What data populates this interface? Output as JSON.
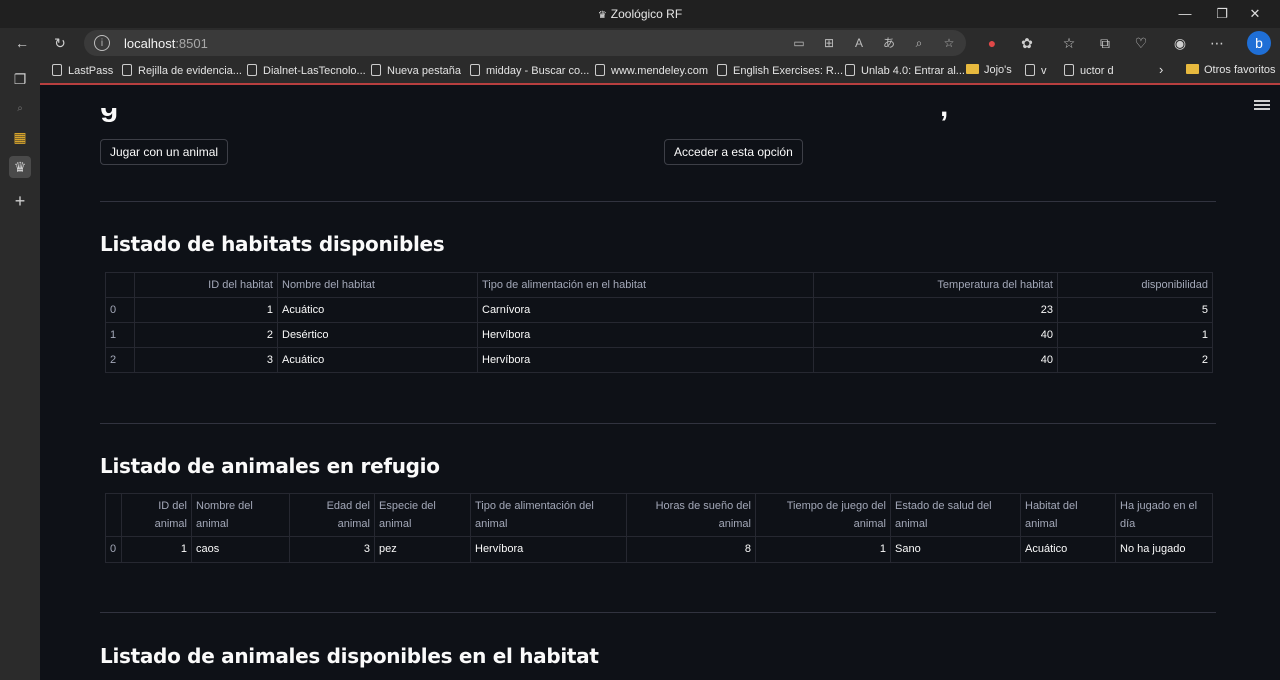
{
  "window": {
    "title": "Zoológico RF"
  },
  "browser": {
    "url_host": "localhost",
    "url_port": ":8501",
    "bookmarks": [
      "LastPass",
      "Rejilla de evidencia...",
      "Dialnet-LasTecnolo...",
      "Nueva pestaña",
      "midday - Buscar co...",
      "www.mendeley.com",
      "English Exercises: R...",
      "Unlab 4.0: Entrar al...",
      "Jojo's",
      "v",
      "uctor d"
    ],
    "other_favorites": "Otros favoritos"
  },
  "actions": {
    "play_button": "Jugar con un animal",
    "access_button": "Acceder a esta opción"
  },
  "habitats": {
    "heading": "Listado de habitats disponibles",
    "columns": [
      "ID del habitat",
      "Nombre del habitat",
      "Tipo de alimentación en el habitat",
      "Temperatura del habitat",
      "disponibilidad"
    ],
    "rows": [
      {
        "index": "0",
        "id": "1",
        "nombre": "Acuático",
        "tipo": "Carnívora",
        "temp": "23",
        "disp": "5"
      },
      {
        "index": "1",
        "id": "2",
        "nombre": "Desértico",
        "tipo": "Hervíbora",
        "temp": "40",
        "disp": "1"
      },
      {
        "index": "2",
        "id": "3",
        "nombre": "Acuático",
        "tipo": "Hervíbora",
        "temp": "40",
        "disp": "2"
      }
    ]
  },
  "animals": {
    "heading": "Listado de animales en refugio",
    "columns": [
      "ID del animal",
      "Nombre del animal",
      "Edad del animal",
      "Especie del animal",
      "Tipo de alimentación del animal",
      "Horas de sueño del animal",
      "Tiempo de juego del animal",
      "Estado de salud del animal",
      "Habitat del animal",
      "Ha jugado en el día"
    ],
    "rows": [
      {
        "index": "0",
        "id": "1",
        "nombre": "caos",
        "edad": "3",
        "especie": "pez",
        "tipo": "Hervíbora",
        "horas": "8",
        "juego": "1",
        "salud": "Sano",
        "habitat": "Acuático",
        "jugado": "No ha jugado"
      }
    ]
  },
  "habitat_animals": {
    "heading": "Listado de animales disponibles en el habitat"
  }
}
